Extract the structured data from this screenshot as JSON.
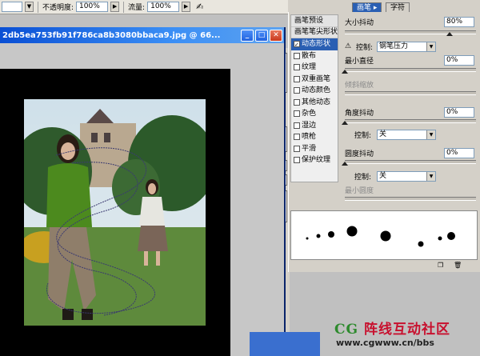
{
  "options_bar": {
    "flow_label_left": "%",
    "opacity_label": "不透明度:",
    "opacity_value": "100%",
    "flow_label": "流量:",
    "flow_value": "100%"
  },
  "document": {
    "title": "2db5ea753fb91f786ca8b3080bbaca9.jpg @ 66..."
  },
  "tabs": {
    "brush": "画笔",
    "character": "字符"
  },
  "brush_panel": {
    "list": [
      {
        "label": "画笔预设",
        "type": "head"
      },
      {
        "label": "画笔笔尖形状",
        "type": "head"
      },
      {
        "label": "动态形状",
        "checked": true,
        "selected": true
      },
      {
        "label": "散布",
        "checked": false
      },
      {
        "label": "纹理",
        "checked": false
      },
      {
        "label": "双重画笔",
        "checked": false
      },
      {
        "label": "动态颜色",
        "checked": false
      },
      {
        "label": "其他动态",
        "checked": false
      },
      {
        "label": "杂色",
        "checked": false
      },
      {
        "label": "湿边",
        "checked": false
      },
      {
        "label": "喷枪",
        "checked": false
      },
      {
        "label": "平滑",
        "checked": false
      },
      {
        "label": "保护纹理",
        "checked": false
      }
    ],
    "size_jitter": {
      "label": "大小抖动",
      "value": "80%",
      "fraction": 0.8
    },
    "size_control": {
      "label": "控制:",
      "value": "钢笔压力"
    },
    "min_diameter": {
      "label": "最小直径",
      "value": "0%",
      "fraction": 0.0
    },
    "tilt_scale": {
      "label": "倾斜缩放"
    },
    "angle_jitter": {
      "label": "角度抖动",
      "value": "0%",
      "fraction": 0.0
    },
    "angle_control": {
      "label": "控制:",
      "value": "关"
    },
    "roundness_jitter": {
      "label": "圆度抖动",
      "value": "0%",
      "fraction": 0.0
    },
    "roundness_control": {
      "label": "控制:",
      "value": "关"
    },
    "min_roundness": {
      "label": "最小圆度"
    }
  },
  "watermark": {
    "brand_cg": "CG",
    "brand_rest": "阵线互动社区",
    "url": "www.cgwww.cn/bbs"
  },
  "colors": {
    "title_blue": "#0a4fd4",
    "selection_blue": "#2a5fb3",
    "brand_red": "#c8102e",
    "brand_green": "#2d8a2d"
  }
}
